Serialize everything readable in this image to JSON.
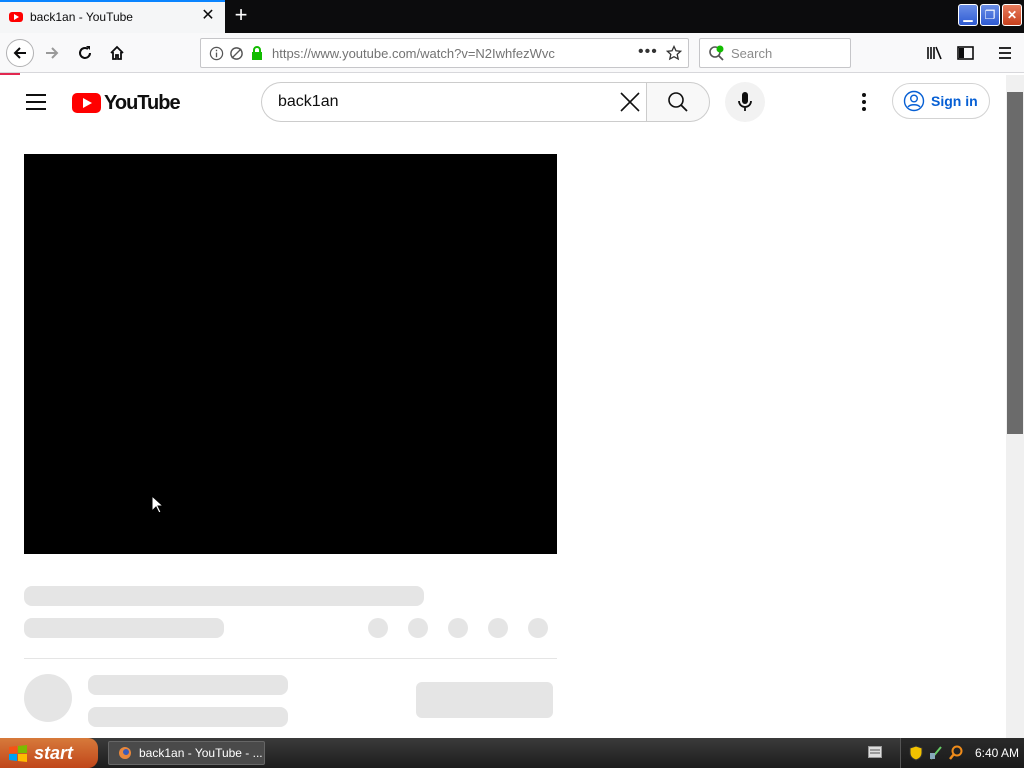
{
  "browser": {
    "tab_title": "back1an - YouTube",
    "url": "https://www.youtube.com/watch?v=N2IwhfezWvc",
    "search_placeholder": "Search"
  },
  "youtube": {
    "logo_text": "YouTube",
    "search_value": "back1an",
    "sign_in_label": "Sign in"
  },
  "taskbar": {
    "start_label": "start",
    "task_item_label": "back1an - YouTube - ...",
    "clock": "6:40 AM"
  },
  "colors": {
    "youtube_red": "#ff0000",
    "signin_blue": "#065fd4",
    "start_orange": "#d4622a"
  }
}
